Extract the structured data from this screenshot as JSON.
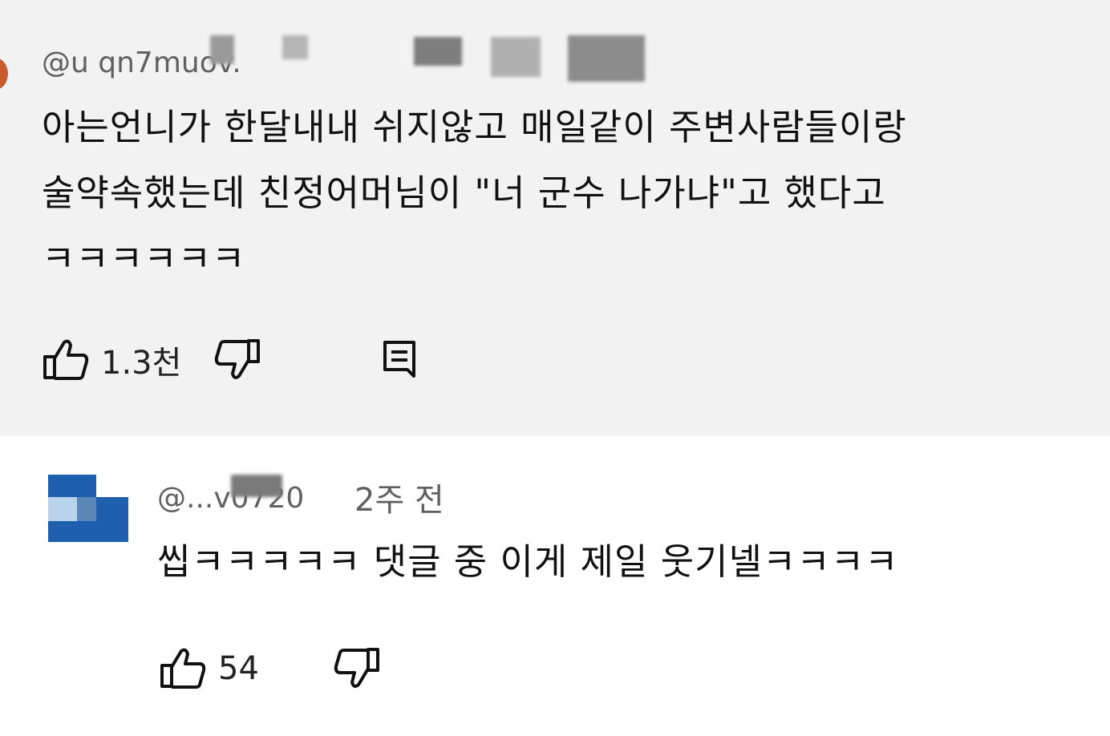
{
  "top_comment": {
    "handle": "@u   qn7muov.",
    "text_lines": [
      "아는언니가 한달내내 쉬지않고 매일같이 주변사람들이랑",
      "술약속했는데 친정어머님이 \"너 군수 나가냐\"고 했다고",
      "ㅋㅋㅋㅋㅋㅋ"
    ],
    "likes": "1.3천",
    "icons": {
      "like": "thumbs-up-icon",
      "dislike": "thumbs-down-icon",
      "reply": "reply-icon"
    }
  },
  "reply": {
    "handle": "@...v0720",
    "time": "2주 전",
    "text": "씹ㅋㅋㅋㅋㅋ 댓글 중 이게 제일 웃기넬ㅋㅋㅋㅋ",
    "likes": "54",
    "icons": {
      "like": "thumbs-up-icon",
      "dislike": "thumbs-down-icon"
    }
  },
  "colors": {
    "top_background": "#f2f2f2",
    "reply_background": "#ffffff",
    "avatar_blue": "#1e5fb0"
  }
}
